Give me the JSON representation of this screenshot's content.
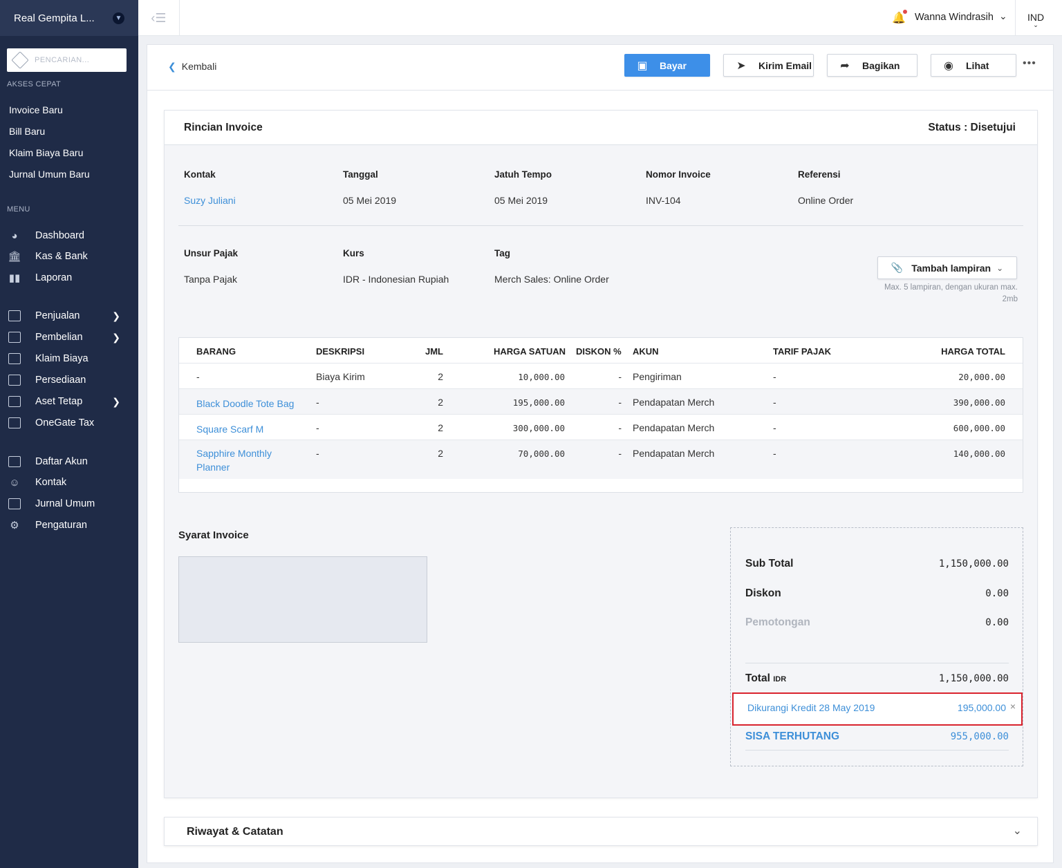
{
  "sidebar": {
    "company": "Real Gempita L...",
    "search_placeholder": "PENCARIAN...",
    "quick_label": "AKSES CEPAT",
    "quick": [
      "Invoice Baru",
      "Bill Baru",
      "Klaim Biaya Baru",
      "Jurnal Umum Baru"
    ],
    "menu_label": "MENU",
    "menu": [
      {
        "label": "Dashboard",
        "icon": "dashboard-icon"
      },
      {
        "label": "Kas & Bank",
        "icon": "bank-icon"
      },
      {
        "label": "Laporan",
        "icon": "report-icon"
      },
      {
        "label": "Penjualan",
        "icon": "sales-icon"
      },
      {
        "label": "Pembelian",
        "icon": "purchase-icon"
      },
      {
        "label": "Klaim Biaya",
        "icon": "wallet-icon"
      },
      {
        "label": "Persediaan",
        "icon": "inventory-icon"
      },
      {
        "label": "Aset Tetap",
        "icon": "folder-icon"
      },
      {
        "label": "OneGate Tax",
        "icon": "tax-icon"
      },
      {
        "label": "Daftar Akun",
        "icon": "accounts-icon"
      },
      {
        "label": "Kontak",
        "icon": "contact-icon"
      },
      {
        "label": "Jurnal Umum",
        "icon": "journal-icon"
      },
      {
        "label": "Pengaturan",
        "icon": "settings-icon"
      }
    ]
  },
  "topbar": {
    "user": "Wanna Windrasih",
    "lang": "IND"
  },
  "actions": {
    "back": "Kembali",
    "pay": "Bayar",
    "email": "Kirim Email",
    "share": "Bagikan",
    "view": "Lihat",
    "more": "•••"
  },
  "invoice": {
    "title": "Rincian Invoice",
    "status": "Status : Disetujui",
    "fields1": [
      {
        "label": "Kontak",
        "value": "Suzy Juliani"
      },
      {
        "label": "Tanggal",
        "value": "05 Mei 2019"
      },
      {
        "label": "Jatuh Tempo",
        "value": "05 Mei 2019"
      },
      {
        "label": "Nomor Invoice",
        "value": "INV-104"
      },
      {
        "label": "Referensi",
        "value": "Online Order"
      }
    ],
    "fields2": [
      {
        "label": "Unsur Pajak",
        "value": "Tanpa Pajak"
      },
      {
        "label": "Kurs",
        "value": "IDR - Indonesian Rupiah"
      },
      {
        "label": "Tag",
        "value": "Merch Sales: Online Order"
      }
    ],
    "attach_label": "Tambah lampiran",
    "attach_note": "Max. 5 lampiran, dengan ukuran max. 2mb"
  },
  "table": {
    "headers": [
      "BARANG",
      "DESKRIPSI",
      "JML",
      "HARGA SATUAN",
      "DISKON %",
      "AKUN",
      "TARIF PAJAK",
      "HARGA TOTAL"
    ],
    "rows": [
      {
        "item": "-",
        "desc": "Biaya Kirim",
        "qty": "2",
        "price": "10,000.00",
        "disc": "-",
        "account": "Pengiriman",
        "tax": "-",
        "total": "20,000.00"
      },
      {
        "item": "Black Doodle Tote Bag",
        "desc": "-",
        "qty": "2",
        "price": "195,000.00",
        "disc": "-",
        "account": "Pendapatan Merch",
        "tax": "-",
        "total": "390,000.00"
      },
      {
        "item": "Square Scarf M",
        "desc": "-",
        "qty": "2",
        "price": "300,000.00",
        "disc": "-",
        "account": "Pendapatan Merch",
        "tax": "-",
        "total": "600,000.00"
      },
      {
        "item": "Sapphire Monthly Planner",
        "desc": "-",
        "qty": "2",
        "price": "70,000.00",
        "disc": "-",
        "account": "Pendapatan Merch",
        "tax": "-",
        "total": "140,000.00"
      }
    ]
  },
  "terms": {
    "title": "Syarat Invoice"
  },
  "totals": {
    "subtotal_label": "Sub Total",
    "subtotal": "1,150,000.00",
    "discount_label": "Diskon",
    "discount": "0.00",
    "withholding_label": "Pemotongan",
    "withholding": "0.00",
    "total_label": "Total",
    "total_currency": "IDR",
    "total": "1,150,000.00",
    "credit_label": "Dikurangi Kredit 28 May 2019",
    "credit": "195,000.00",
    "remaining_label": "SISA TERHUTANG",
    "remaining": "955,000.00"
  },
  "history": {
    "title": "Riwayat & Catatan"
  },
  "colors": {
    "accent": "#3d8fe8",
    "sidebar": "#1f2b47",
    "highlight": "#d9232d"
  }
}
